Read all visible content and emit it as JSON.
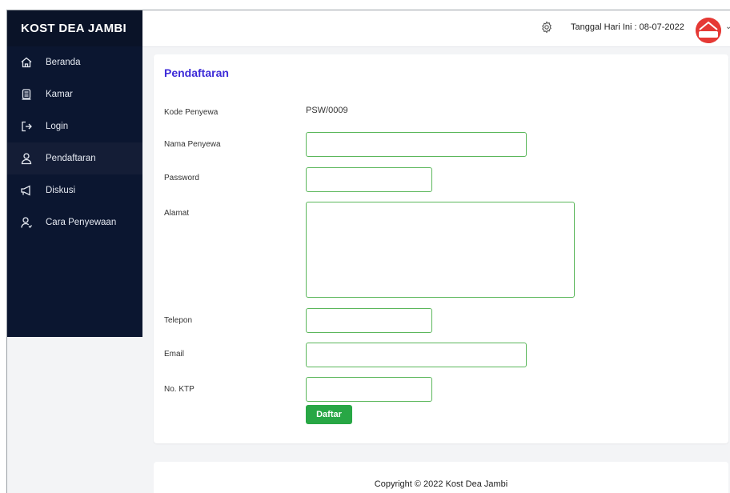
{
  "brand": "KOST DEA JAMBI",
  "sidebar": {
    "items": [
      {
        "label": "Beranda",
        "icon": "home-icon"
      },
      {
        "label": "Kamar",
        "icon": "room-icon"
      },
      {
        "label": "Login",
        "icon": "login-icon"
      },
      {
        "label": "Pendaftaran",
        "icon": "user-icon",
        "active": true
      },
      {
        "label": "Diskusi",
        "icon": "megaphone-icon"
      },
      {
        "label": "Cara Penyewaan",
        "icon": "user-guide-icon"
      }
    ]
  },
  "topbar": {
    "date_text": "Tanggal Hari Ini : 08-07-2022",
    "logo_text": "KOST"
  },
  "form": {
    "title": "Pendaftaran",
    "kode_label": "Kode Penyewa",
    "kode_value": "PSW/0009",
    "nama_label": "Nama Penyewa",
    "nama_value": "",
    "password_label": "Password",
    "password_value": "",
    "alamat_label": "Alamat",
    "alamat_value": "",
    "telepon_label": "Telepon",
    "telepon_value": "",
    "email_label": "Email",
    "email_value": "",
    "ktp_label": "No. KTP",
    "ktp_value": "",
    "submit_label": "Daftar"
  },
  "footer": {
    "text": "Copyright © 2022 Kost Dea Jambi"
  },
  "colors": {
    "sidebar_bg": "#0b1630",
    "title_accent": "#3d2bd8",
    "field_border": "#5bb75b",
    "button_bg": "#28a745",
    "logo_bg": "#e53935"
  }
}
